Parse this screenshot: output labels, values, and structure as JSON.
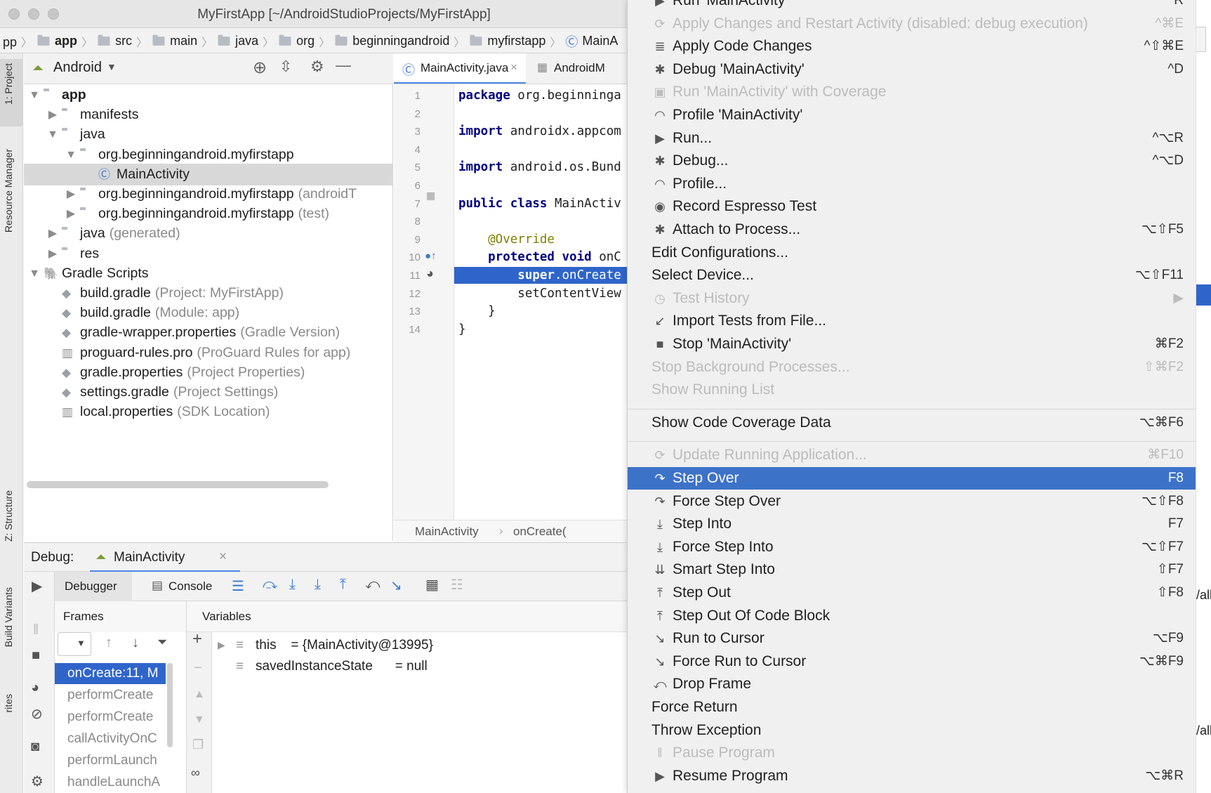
{
  "window": {
    "title": "MyFirstApp [~/AndroidStudioProjects/MyFirstApp]"
  },
  "breadcrumbs": [
    "pp",
    "app",
    "src",
    "main",
    "java",
    "org",
    "beginningandroid",
    "myfirstapp",
    "MainA"
  ],
  "left_strip": {
    "project": "1: Project",
    "resource_manager": "Resource Manager",
    "structure": "Z: Structure",
    "build_variants": "Build Variants",
    "favorites": "rites"
  },
  "project_panel": {
    "view_selector": "Android",
    "tree": [
      {
        "label": "app",
        "suffix": "",
        "depth": 0,
        "expanded": true,
        "bold": true
      },
      {
        "label": "manifests",
        "suffix": "",
        "depth": 1,
        "expanded": false
      },
      {
        "label": "java",
        "suffix": "",
        "depth": 1,
        "expanded": true
      },
      {
        "label": "org.beginningandroid.myfirstapp",
        "suffix": "",
        "depth": 2,
        "expanded": true
      },
      {
        "label": "MainActivity",
        "suffix": "",
        "depth": 3,
        "selected": true
      },
      {
        "label": "org.beginningandroid.myfirstapp",
        "suffix": "(androidT",
        "depth": 2,
        "expanded": false
      },
      {
        "label": "org.beginningandroid.myfirstapp",
        "suffix": "(test)",
        "depth": 2,
        "expanded": false
      },
      {
        "label": "java",
        "suffix": "(generated)",
        "depth": 1,
        "expanded": false
      },
      {
        "label": "res",
        "suffix": "",
        "depth": 1,
        "expanded": false
      },
      {
        "label": "Gradle Scripts",
        "suffix": "",
        "depth": 0,
        "expanded": true
      },
      {
        "label": "build.gradle",
        "suffix": "(Project: MyFirstApp)",
        "depth": 1
      },
      {
        "label": "build.gradle",
        "suffix": "(Module: app)",
        "depth": 1
      },
      {
        "label": "gradle-wrapper.properties",
        "suffix": "(Gradle Version)",
        "depth": 1
      },
      {
        "label": "proguard-rules.pro",
        "suffix": "(ProGuard Rules for app)",
        "depth": 1
      },
      {
        "label": "gradle.properties",
        "suffix": "(Project Properties)",
        "depth": 1
      },
      {
        "label": "settings.gradle",
        "suffix": "(Project Settings)",
        "depth": 1
      },
      {
        "label": "local.properties",
        "suffix": "(SDK Location)",
        "depth": 1
      }
    ]
  },
  "editor": {
    "tabs": [
      {
        "label": "MainActivity.java",
        "active": true
      },
      {
        "label": "AndroidM",
        "active": false
      }
    ],
    "lines": [
      {
        "n": "1",
        "parts": [
          {
            "t": "package",
            "c": "kw"
          },
          {
            "t": " org.beginninga",
            "c": ""
          }
        ]
      },
      {
        "n": "2",
        "parts": []
      },
      {
        "n": "3",
        "parts": [
          {
            "t": "import",
            "c": "kw"
          },
          {
            "t": " androidx.appcom",
            "c": ""
          }
        ]
      },
      {
        "n": "4",
        "parts": []
      },
      {
        "n": "5",
        "parts": [
          {
            "t": "import",
            "c": "kw"
          },
          {
            "t": " android.os.Bund",
            "c": ""
          }
        ]
      },
      {
        "n": "6",
        "parts": []
      },
      {
        "n": "7",
        "parts": [
          {
            "t": "public class",
            "c": "kw"
          },
          {
            "t": " MainActiv",
            "c": ""
          }
        ]
      },
      {
        "n": "8",
        "parts": []
      },
      {
        "n": "9",
        "parts": [
          {
            "t": "    @Override",
            "c": "ann"
          }
        ]
      },
      {
        "n": "10",
        "parts": [
          {
            "t": "    protected void",
            "c": "kw"
          },
          {
            "t": " onC",
            "c": ""
          }
        ]
      },
      {
        "n": "11",
        "parts": [
          {
            "t": "        super",
            "c": "kw"
          },
          {
            "t": ".onCreate",
            "c": ""
          }
        ],
        "highlight": true
      },
      {
        "n": "12",
        "parts": [
          {
            "t": "        setContentView",
            "c": ""
          }
        ]
      },
      {
        "n": "13",
        "parts": [
          {
            "t": "    }",
            "c": ""
          }
        ]
      },
      {
        "n": "14",
        "parts": [
          {
            "t": "}",
            "c": ""
          }
        ]
      }
    ],
    "crumbs": [
      "MainActivity",
      "onCreate("
    ]
  },
  "debug": {
    "label": "Debug:",
    "session_tab": "MainActivity",
    "debugger_tab": "Debugger",
    "console_tab": "Console",
    "frames_header": "Frames",
    "variables_header": "Variables",
    "frames": [
      "onCreate:11, M",
      "performCreate",
      "performCreate",
      "callActivityOnC",
      "performLaunch",
      "handleLaunchA"
    ],
    "variables": [
      {
        "name": "this",
        "value": "= {MainActivity@13995}",
        "expandable": true
      },
      {
        "name": "savedInstanceState",
        "value": "= null",
        "expandable": false
      }
    ]
  },
  "menu": {
    "items": [
      {
        "label": "Run 'MainActivity'",
        "shortcut": "R",
        "icon": "run-icon",
        "glyph": "▶",
        "disabled": false,
        "cut": true
      },
      {
        "label": "Apply Changes and Restart Activity (disabled: debug execution)",
        "shortcut": "^⌘E",
        "icon": "apply-changes-icon",
        "glyph": "⟳",
        "disabled": true
      },
      {
        "label": "Apply Code Changes",
        "shortcut": "^⇧⌘E",
        "icon": "apply-code-icon",
        "glyph": "≣",
        "disabled": false
      },
      {
        "label": "Debug 'MainActivity'",
        "shortcut": "^D",
        "icon": "bug-icon",
        "glyph": "✱",
        "disabled": false
      },
      {
        "label": "Run 'MainActivity' with Coverage",
        "shortcut": "",
        "icon": "coverage-icon",
        "glyph": "▣",
        "disabled": true
      },
      {
        "label": "Profile 'MainActivity'",
        "shortcut": "",
        "icon": "profiler-icon",
        "glyph": "◠",
        "disabled": false
      },
      {
        "label": "Run...",
        "shortcut": "^⌥R",
        "icon": "run-icon",
        "glyph": "▶",
        "disabled": false
      },
      {
        "label": "Debug...",
        "shortcut": "^⌥D",
        "icon": "bug-icon",
        "glyph": "✱",
        "disabled": false
      },
      {
        "label": "Profile...",
        "shortcut": "",
        "icon": "profiler-icon",
        "glyph": "◠",
        "disabled": false
      },
      {
        "label": "Record Espresso Test",
        "shortcut": "",
        "icon": "espresso-icon",
        "glyph": "◉",
        "disabled": false
      },
      {
        "label": "Attach to Process...",
        "shortcut": "⌥⇧F5",
        "icon": "attach-icon",
        "glyph": "✱",
        "disabled": false
      },
      {
        "label": "Edit Configurations...",
        "shortcut": "",
        "icon": "",
        "glyph": "",
        "disabled": false
      },
      {
        "label": "Select Device...",
        "shortcut": "⌥⇧F11",
        "icon": "",
        "glyph": "",
        "disabled": false
      },
      {
        "label": "Test History",
        "shortcut": "▶",
        "icon": "clock-icon",
        "glyph": "◷",
        "disabled": true
      },
      {
        "label": "Import Tests from File...",
        "shortcut": "",
        "icon": "import-icon",
        "glyph": "↙",
        "disabled": false
      },
      {
        "label": "Stop 'MainActivity'",
        "shortcut": "⌘F2",
        "icon": "stop-icon",
        "glyph": "■",
        "disabled": false
      },
      {
        "label": "Stop Background Processes...",
        "shortcut": "⇧⌘F2",
        "icon": "",
        "glyph": "",
        "disabled": true
      },
      {
        "label": "Show Running List",
        "shortcut": "",
        "icon": "",
        "glyph": "",
        "disabled": true
      },
      {
        "label": "Show Code Coverage Data",
        "shortcut": "⌥⌘F6",
        "icon": "",
        "glyph": "",
        "disabled": false,
        "sep_before": true
      },
      {
        "label": "Update Running Application...",
        "shortcut": "⌘F10",
        "icon": "refresh-icon",
        "glyph": "⟳",
        "disabled": true,
        "sep_before": true
      },
      {
        "label": "Step Over",
        "shortcut": "F8",
        "icon": "step-over-icon",
        "glyph": "↷",
        "disabled": false,
        "highlighted": true
      },
      {
        "label": "Force Step Over",
        "shortcut": "⌥⇧F8",
        "icon": "force-step-over-icon",
        "glyph": "↷",
        "disabled": false
      },
      {
        "label": "Step Into",
        "shortcut": "F7",
        "icon": "step-into-icon",
        "glyph": "⤓",
        "disabled": false
      },
      {
        "label": "Force Step Into",
        "shortcut": "⌥⇧F7",
        "icon": "force-step-into-icon",
        "glyph": "⤓",
        "disabled": false
      },
      {
        "label": "Smart Step Into",
        "shortcut": "⇧F7",
        "icon": "smart-step-into-icon",
        "glyph": "⇊",
        "disabled": false
      },
      {
        "label": "Step Out",
        "shortcut": "⇧F8",
        "icon": "step-out-icon",
        "glyph": "⤒",
        "disabled": false
      },
      {
        "label": "Step Out Of Code Block",
        "shortcut": "",
        "icon": "step-out-block-icon",
        "glyph": "⤒",
        "disabled": false
      },
      {
        "label": "Run to Cursor",
        "shortcut": "⌥F9",
        "icon": "run-to-cursor-icon",
        "glyph": "↘",
        "disabled": false
      },
      {
        "label": "Force Run to Cursor",
        "shortcut": "⌥⌘F9",
        "icon": "force-run-to-cursor-icon",
        "glyph": "↘",
        "disabled": false
      },
      {
        "label": "Drop Frame",
        "shortcut": "",
        "icon": "drop-frame-icon",
        "glyph": "⤺",
        "disabled": false
      },
      {
        "label": "Force Return",
        "shortcut": "",
        "icon": "",
        "glyph": "",
        "disabled": false
      },
      {
        "label": "Throw Exception",
        "shortcut": "",
        "icon": "",
        "glyph": "",
        "disabled": false
      },
      {
        "label": "Pause Program",
        "shortcut": "",
        "icon": "pause-icon",
        "glyph": "‖",
        "disabled": true
      },
      {
        "label": "Resume Program",
        "shortcut": "⌥⌘R",
        "icon": "resume-icon",
        "glyph": "▶",
        "disabled": false
      }
    ]
  },
  "right_edge": {
    "text_a": "/all",
    "text_b": "/all"
  },
  "colors": {
    "menu_highlight": "#3d72c9",
    "selection": "#2f65ca",
    "keyword": "#000080"
  }
}
